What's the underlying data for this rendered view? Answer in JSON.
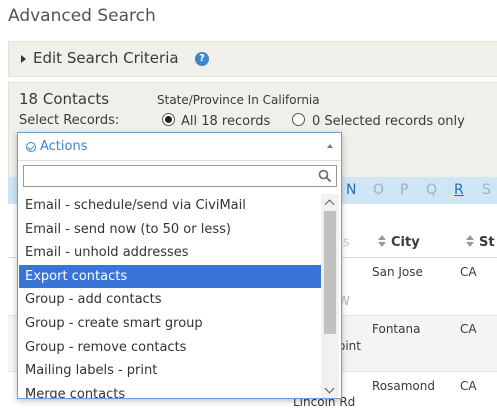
{
  "page": {
    "title": "Advanced Search"
  },
  "criteria": {
    "label": "Edit Search Criteria",
    "help": "?"
  },
  "results": {
    "count_text": "18 Contacts",
    "criteria_text": "State/Province In California",
    "select_label": "Select Records:",
    "radio_all": "All 18 records",
    "radio_selected": "0 Selected records only",
    "selected_option": "all"
  },
  "actions": {
    "label": "Actions",
    "search_value": "",
    "items": [
      "Email - schedule/send via CiviMail",
      "Email - send now (to 50 or less)",
      "Email - unhold addresses",
      "Export contacts",
      "Group - add contacts",
      "Group - create smart group",
      "Group - remove contacts",
      "Mailing labels - print",
      "Merge contacts"
    ],
    "highlighted": "Export contacts"
  },
  "alphabet": {
    "letters": [
      "N",
      "O",
      "P",
      "Q",
      "R",
      "S"
    ],
    "active": "R"
  },
  "table": {
    "headers": {
      "address_partial": "ss",
      "city": "City",
      "state_partial": "St"
    },
    "rows": [
      {
        "address": "",
        "city": "San Jose",
        "state": "CA"
      },
      {
        "address": "oint",
        "city": "Fontana",
        "state": "CA"
      },
      {
        "address": "Lincoln Rd",
        "city": "Rosamond",
        "state": "CA"
      }
    ]
  },
  "colors": {
    "accent": "#3f86c6",
    "highlight": "#3875d7",
    "panel": "#f0efe9",
    "alpha_bar": "#cfe6f7"
  }
}
